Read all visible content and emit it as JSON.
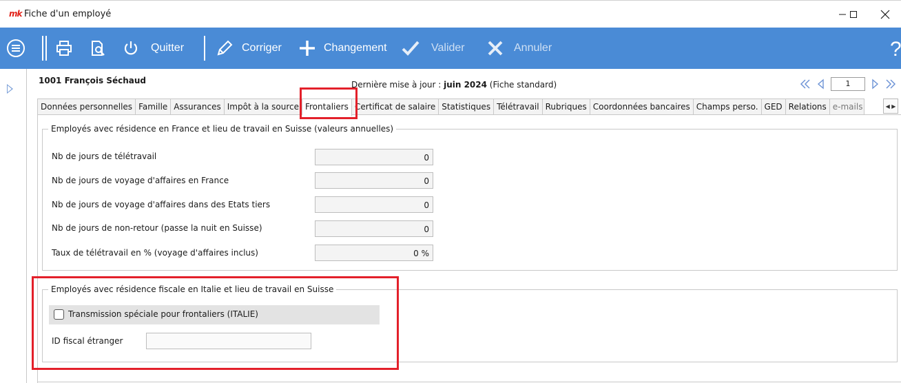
{
  "window": {
    "title": "Fiche d'un employé",
    "logo": "mk"
  },
  "toolbar": {
    "quit_label": "Quitter",
    "edit_label": "Corriger",
    "change_label": "Changement",
    "validate_label": "Valider",
    "cancel_label": "Annuler",
    "help_label": "?"
  },
  "header": {
    "employee": "1001 François Séchaud",
    "last_update_label": "Dernière mise à jour :",
    "last_update_value": "juin 2024",
    "last_update_note": "(Fiche standard)",
    "page": "1"
  },
  "tabs": [
    {
      "label": "Données personnelles"
    },
    {
      "label": "Famille"
    },
    {
      "label": "Assurances"
    },
    {
      "label": "Impôt à la source"
    },
    {
      "label": "Frontaliers"
    },
    {
      "label": "Certificat de salaire"
    },
    {
      "label": "Statistiques"
    },
    {
      "label": "Télétravail"
    },
    {
      "label": "Rubriques"
    },
    {
      "label": "Coordonnées bancaires"
    },
    {
      "label": "Champs perso."
    },
    {
      "label": "GED"
    },
    {
      "label": "Relations"
    },
    {
      "label": "e-mails"
    }
  ],
  "france_group": {
    "legend": "Employés avec résidence en France et lieu de travail en Suisse (valeurs annuelles)",
    "fields": [
      {
        "label": "Nb de jours de télétravail",
        "value": "0"
      },
      {
        "label": "Nb de jours de voyage d'affaires en France",
        "value": "0"
      },
      {
        "label": "Nb de jours de voyage d'affaires dans des Etats tiers",
        "value": "0"
      },
      {
        "label": "Nb de jours de non-retour (passe la nuit en Suisse)",
        "value": "0"
      },
      {
        "label": "Taux de télétravail en % (voyage d'affaires inclus)",
        "value": "0 %"
      }
    ]
  },
  "italy_group": {
    "legend": "Employés avec résidence fiscale en Italie et lieu de travail en Suisse",
    "checkbox_label": "Transmission spéciale pour frontaliers (ITALIE)",
    "foreign_id_label": "ID fiscal étranger",
    "foreign_id_value": ""
  },
  "colors": {
    "toolbar": "#4a8bd6",
    "highlight": "#e3202a"
  }
}
